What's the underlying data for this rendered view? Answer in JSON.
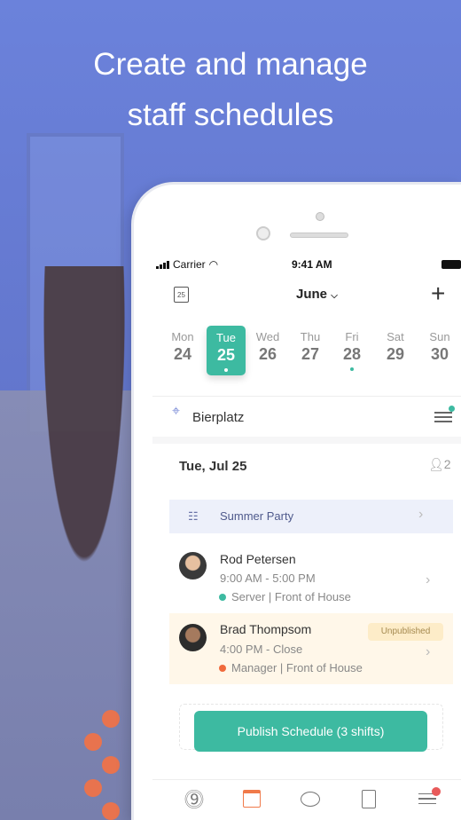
{
  "headline": {
    "line1": "Create and manage",
    "line2": "staff schedules"
  },
  "status": {
    "carrier": "Carrier",
    "time": "9:41 AM"
  },
  "header": {
    "month": "June",
    "calendar_day": "25",
    "add": "+"
  },
  "week": [
    {
      "name": "Mon",
      "date": "24",
      "selected": false,
      "dot": false
    },
    {
      "name": "Tue",
      "date": "25",
      "selected": true,
      "dot": true
    },
    {
      "name": "Wed",
      "date": "26",
      "selected": false,
      "dot": false
    },
    {
      "name": "Thu",
      "date": "27",
      "selected": false,
      "dot": false
    },
    {
      "name": "Fri",
      "date": "28",
      "selected": false,
      "dot": true
    },
    {
      "name": "Sat",
      "date": "29",
      "selected": false,
      "dot": false
    },
    {
      "name": "Sun",
      "date": "30",
      "selected": false,
      "dot": false
    }
  ],
  "location": "Bierplatz",
  "day_header": {
    "date": "Tue, Jul 25",
    "staff_count": "2"
  },
  "event": {
    "title": "Summer Party"
  },
  "shifts": [
    {
      "name": "Rod Petersen",
      "time": "9:00 AM - 5:00 PM",
      "role": "Server | Front of House",
      "role_color": "#3dbaa1",
      "badge": ""
    },
    {
      "name": "Brad Thompsom",
      "time": "4:00 PM - Close",
      "role": "Manager | Front of House",
      "role_color": "#f06a3c",
      "badge": "Unpublished"
    }
  ],
  "publish_button": "Publish Schedule (3 shifts)",
  "tabbar": [
    {
      "icon": "clock-icon"
    },
    {
      "icon": "calendar-icon",
      "active": true
    },
    {
      "icon": "chat-icon"
    },
    {
      "icon": "clipboard-icon"
    },
    {
      "icon": "menu-icon",
      "notification": true
    }
  ],
  "colors": {
    "accent": "#3dbaa1",
    "active_tab": "#f07a4a",
    "background": "#6a80d6",
    "notification": "#e85a5a"
  }
}
